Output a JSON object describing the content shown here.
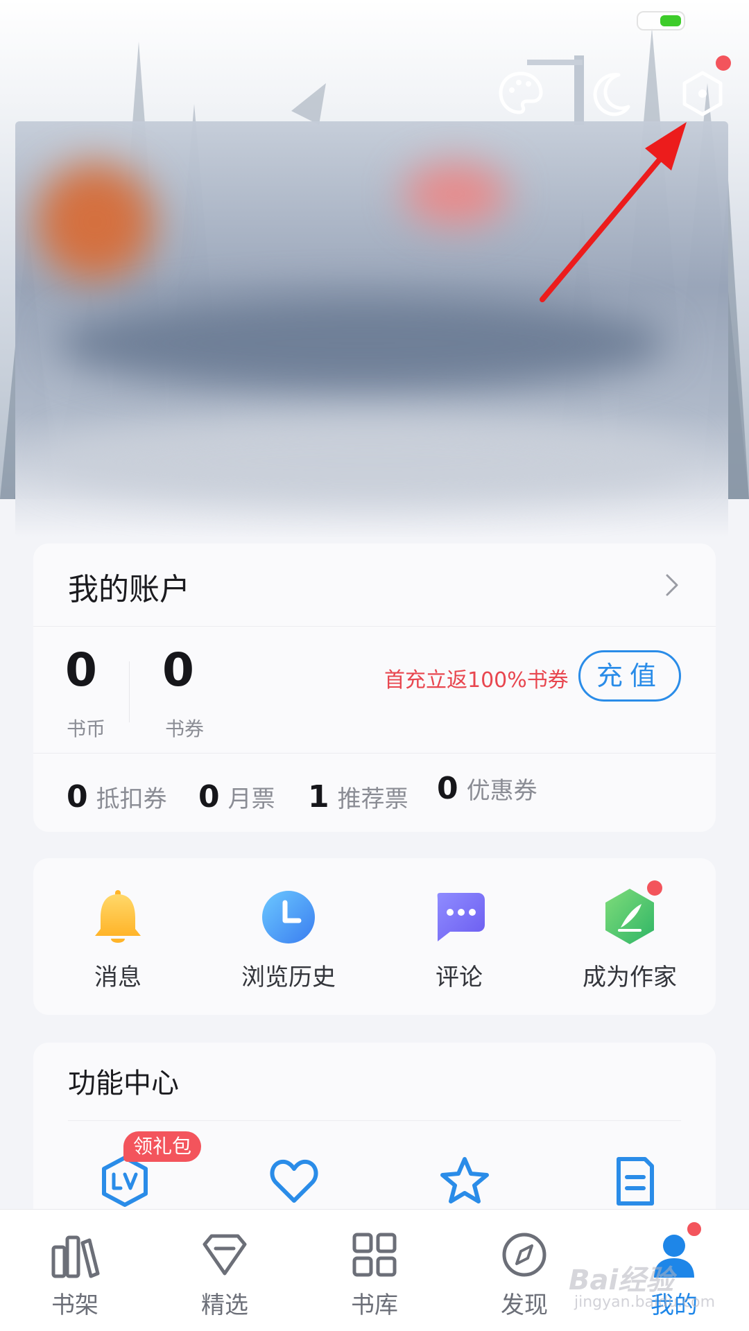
{
  "colors": {
    "accent": "#1e86e8",
    "promo": "#e8464f",
    "badge": "#f3545c",
    "battery": "#3dcc2a"
  },
  "top_icons": [
    "palette-icon",
    "moon-icon",
    "settings-icon"
  ],
  "account": {
    "title": "我的账户",
    "coins_value": "0",
    "coins_label": "书币",
    "vouchers_value": "0",
    "vouchers_label": "书券",
    "promo_text": "首充立返100%书券",
    "recharge_label": "充值",
    "stats": [
      {
        "value": "0",
        "label": "抵扣券"
      },
      {
        "value": "0",
        "label": "月票"
      },
      {
        "value": "1",
        "label": "推荐票"
      },
      {
        "value": "0",
        "label": "优惠券"
      }
    ]
  },
  "quick": [
    {
      "label": "消息",
      "icon": "bell-icon"
    },
    {
      "label": "浏览历史",
      "icon": "clock-icon"
    },
    {
      "label": "评论",
      "icon": "comment-icon"
    },
    {
      "label": "成为作家",
      "icon": "pen-icon"
    }
  ],
  "functions": {
    "title": "功能中心",
    "gift_badge": "领礼包",
    "items": [
      "level-icon",
      "heart-icon",
      "star-icon",
      "document-icon"
    ]
  },
  "nav": [
    {
      "label": "书架",
      "icon": "bookshelf-icon"
    },
    {
      "label": "精选",
      "icon": "diamond-icon"
    },
    {
      "label": "书库",
      "icon": "grid-icon"
    },
    {
      "label": "发现",
      "icon": "compass-icon"
    },
    {
      "label": "我的",
      "icon": "profile-icon",
      "active": true
    }
  ],
  "watermark": {
    "main": "Bai经验",
    "sub": "jingyan.baidu.com"
  }
}
